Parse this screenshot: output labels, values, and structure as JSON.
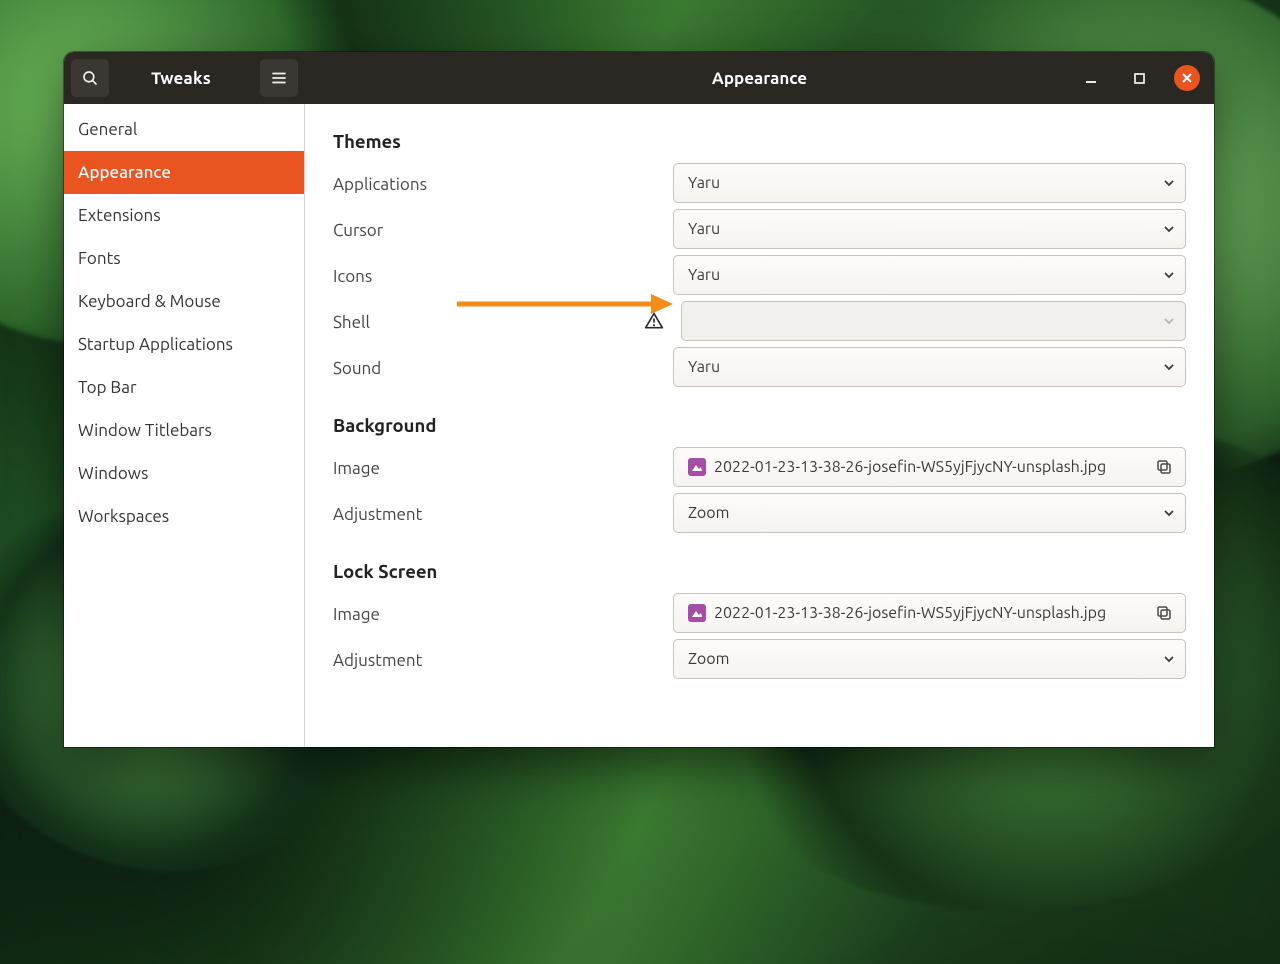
{
  "header": {
    "app_title": "Tweaks",
    "panel_title": "Appearance"
  },
  "sidebar": {
    "items": [
      "General",
      "Appearance",
      "Extensions",
      "Fonts",
      "Keyboard & Mouse",
      "Startup Applications",
      "Top Bar",
      "Window Titlebars",
      "Windows",
      "Workspaces"
    ],
    "active_index": 1
  },
  "content": {
    "themes": {
      "heading": "Themes",
      "applications": {
        "label": "Applications",
        "value": "Yaru"
      },
      "cursor": {
        "label": "Cursor",
        "value": "Yaru"
      },
      "icons": {
        "label": "Icons",
        "value": "Yaru"
      },
      "shell": {
        "label": "Shell",
        "value": "",
        "disabled": true
      },
      "sound": {
        "label": "Sound",
        "value": "Yaru"
      }
    },
    "background": {
      "heading": "Background",
      "image": {
        "label": "Image",
        "value": "2022-01-23-13-38-26-josefin-WS5yjFjycNY-unsplash.jpg"
      },
      "adjustment": {
        "label": "Adjustment",
        "value": "Zoom"
      }
    },
    "lock_screen": {
      "heading": "Lock Screen",
      "image": {
        "label": "Image",
        "value": "2022-01-23-13-38-26-josefin-WS5yjFjycNY-unsplash.jpg"
      },
      "adjustment": {
        "label": "Adjustment",
        "value": "Zoom"
      }
    }
  },
  "colors": {
    "accent": "#e95420"
  }
}
